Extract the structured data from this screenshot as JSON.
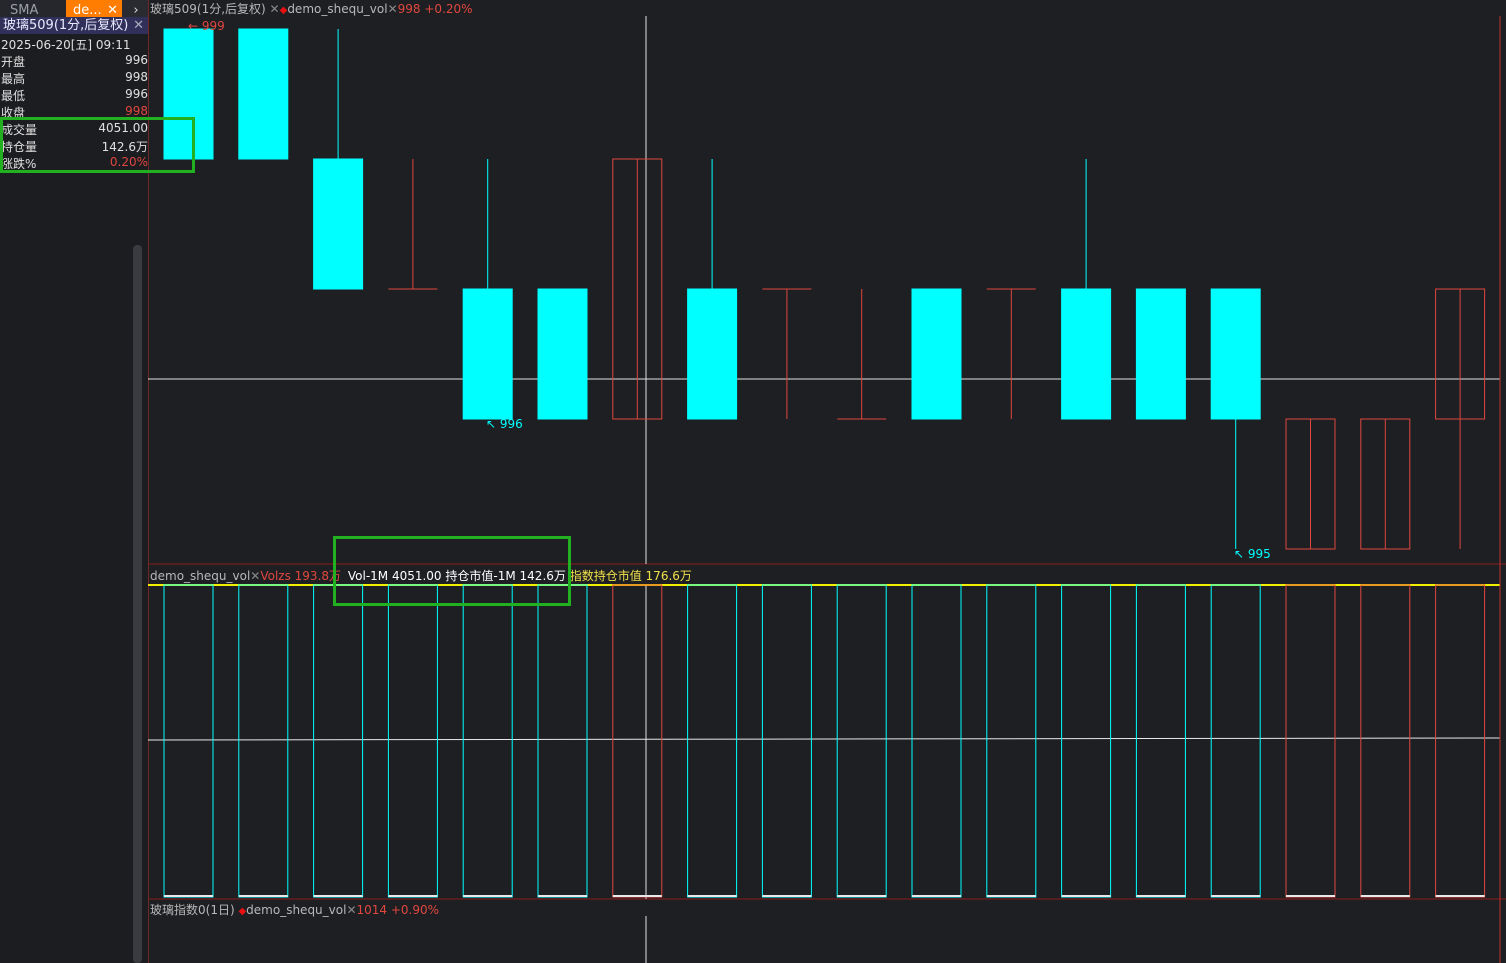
{
  "tabs": {
    "sma": "SMA",
    "de": "de...",
    "close": "✕",
    "next": "›"
  },
  "symbol": {
    "title": "玻璃509(1分,后复权)",
    "close": "✕"
  },
  "datetime": "2025-06-20[五] 09:11",
  "info": [
    {
      "label": "开盘",
      "value": "996",
      "color": "normal"
    },
    {
      "label": "最高",
      "value": "998",
      "color": "normal"
    },
    {
      "label": "最低",
      "value": "996",
      "color": "normal"
    },
    {
      "label": "收盘",
      "value": "998",
      "color": "red"
    },
    {
      "label": "成交量",
      "value": "4051.00",
      "color": "normal"
    },
    {
      "label": "持仓量",
      "value": "142.6万",
      "color": "normal"
    },
    {
      "label": "涨跌%",
      "value": "0.20%",
      "color": "red"
    }
  ],
  "main_header": {
    "symbol": "玻璃509(1分,后复权)",
    "x": "✕",
    "diamond": "◆",
    "indicator": "demo_shequ_vol",
    "x2": "✕",
    "price": "998 +0.20%"
  },
  "sub_header": {
    "indicator": "demo_shequ_vol",
    "x": "✕",
    "volzs": "Volzs 193.8万",
    "vol": "Vol-1M 4051.00",
    "oi": "持仓市值-1M 142.6万",
    "index_oi": "指数持仓市值 176.6万"
  },
  "bottom_header": {
    "symbol": "玻璃指数0(1日)",
    "diamond": "◆",
    "indicator": "demo_shequ_vol",
    "x": "✕",
    "price": "1014 +0.90%"
  },
  "annotations": {
    "high": "999",
    "low1": "996",
    "low2": "995"
  },
  "colors": {
    "up": "#00ffff",
    "down_outline": "#e0473e",
    "accent": "#ff7d00",
    "highlight_box": "#20b020",
    "yellow_line": "#f0f000"
  },
  "chart_data": {
    "type": "candlestick",
    "note": "",
    "candles": [
      {
        "o": 999,
        "h": 999,
        "l": 998,
        "c": 998,
        "dir": "down"
      },
      {
        "o": 999,
        "h": 999,
        "l": 998,
        "c": 998,
        "dir": "down"
      },
      {
        "o": 998,
        "h": 999,
        "l": 997,
        "c": 997,
        "dir": "down"
      },
      {
        "o": 997,
        "h": 998,
        "l": 997,
        "c": 997,
        "dir": "flat"
      },
      {
        "o": 997,
        "h": 998,
        "l": 996,
        "c": 996,
        "dir": "down"
      },
      {
        "o": 997,
        "h": 997,
        "l": 996,
        "c": 996,
        "dir": "down"
      },
      {
        "o": 996,
        "h": 998,
        "l": 996,
        "c": 998,
        "dir": "up"
      },
      {
        "o": 997,
        "h": 998,
        "l": 996,
        "c": 996,
        "dir": "down"
      },
      {
        "o": 997,
        "h": 997,
        "l": 996,
        "c": 997,
        "dir": "flat"
      },
      {
        "o": 996,
        "h": 997,
        "l": 996,
        "c": 996,
        "dir": "flat"
      },
      {
        "o": 997,
        "h": 997,
        "l": 996,
        "c": 996,
        "dir": "down"
      },
      {
        "o": 997,
        "h": 997,
        "l": 996,
        "c": 997,
        "dir": "flat"
      },
      {
        "o": 997,
        "h": 998,
        "l": 996,
        "c": 996,
        "dir": "down"
      },
      {
        "o": 997,
        "h": 997,
        "l": 996,
        "c": 996,
        "dir": "down"
      },
      {
        "o": 997,
        "h": 997,
        "l": 995,
        "c": 996,
        "dir": "down"
      },
      {
        "o": 995,
        "h": 996,
        "l": 995,
        "c": 996,
        "dir": "up"
      },
      {
        "o": 995,
        "h": 996,
        "l": 995,
        "c": 996,
        "dir": "up"
      },
      {
        "o": 996,
        "h": 997,
        "l": 995,
        "c": 997,
        "dir": "up"
      }
    ],
    "volume_dir": [
      "down",
      "down",
      "down",
      "down",
      "down",
      "down",
      "up",
      "down",
      "down",
      "down",
      "down",
      "down",
      "down",
      "down",
      "down",
      "up",
      "up",
      "up"
    ],
    "price_range": [
      995,
      999
    ]
  }
}
